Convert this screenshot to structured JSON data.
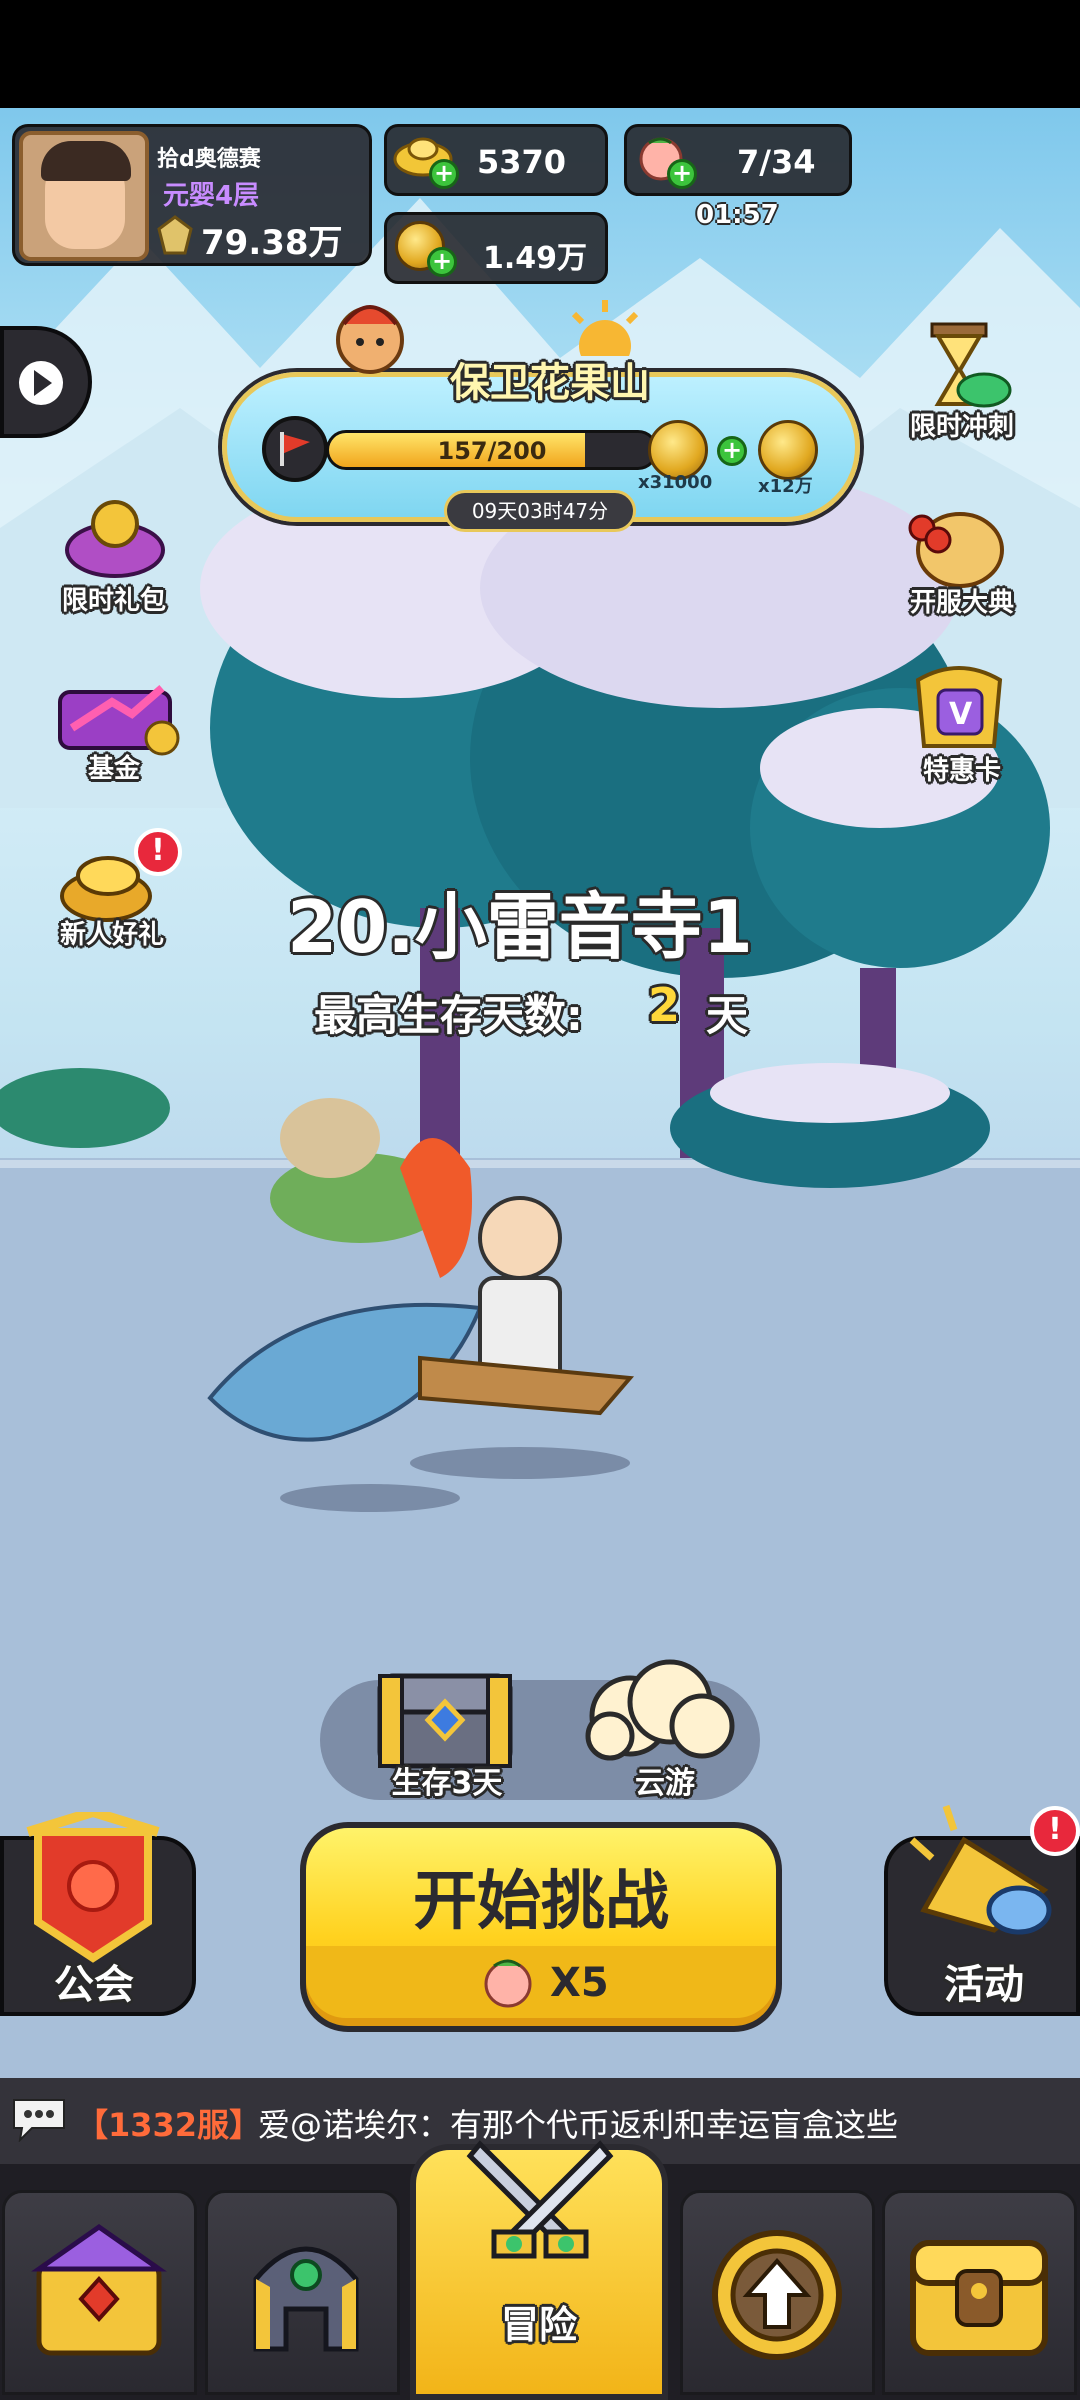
{
  "player": {
    "name": "拾d奥德赛",
    "realm": "元婴4层",
    "power": "79.38万"
  },
  "currency": {
    "gold": "5370",
    "peach": "7/34",
    "peach_timer": "01:57",
    "coins": "1.49万"
  },
  "event": {
    "title": "保卫花果山",
    "progress_text": "157/200",
    "progress": 0.785,
    "reward1": "x31000",
    "reward2": "x12万",
    "timer": "09天03时47分"
  },
  "left_menu": [
    {
      "label": "限时礼包"
    },
    {
      "label": "基金"
    },
    {
      "label": "新人好礼"
    }
  ],
  "right_menu": [
    {
      "label": "限时冲刺"
    },
    {
      "label": "开服大典"
    },
    {
      "label": "特惠卡"
    }
  ],
  "stage": {
    "title": "20.小雷音寺1",
    "survival_label": "最高生存天数:",
    "survival_days": "2",
    "survival_unit": "天"
  },
  "chests": {
    "survive": "生存3天",
    "cloud": "云游"
  },
  "guild": {
    "label": "公会"
  },
  "start": {
    "label": "开始挑战",
    "cost": "X5"
  },
  "activity": {
    "label": "活动"
  },
  "chat": {
    "server": "【1332服】",
    "message": "爱@诺埃尔：有那个代币返利和幸运盲盒这些"
  },
  "nav": {
    "adventure": "冒险"
  }
}
